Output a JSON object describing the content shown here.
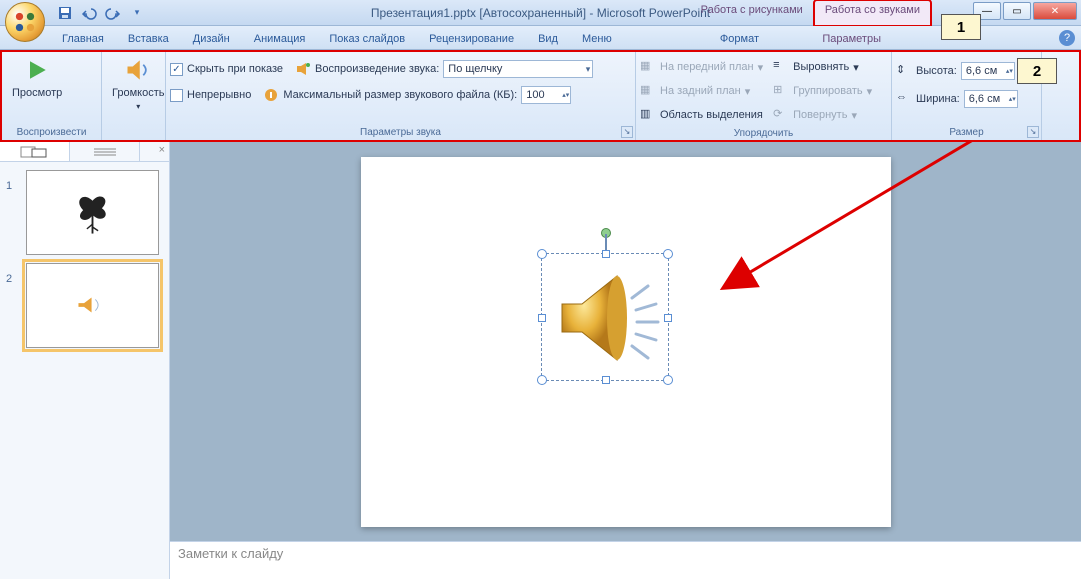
{
  "title": "Презентация1.pptx [Автосохраненный] - Microsoft PowerPoint",
  "context_tabs": {
    "pictures": "Работа с рисунками",
    "sounds": "Работа со звуками"
  },
  "callouts": {
    "c1": "1",
    "c2": "2"
  },
  "tabs": {
    "home": "Главная",
    "insert": "Вставка",
    "design": "Дизайн",
    "animation": "Анимация",
    "slideshow": "Показ слайдов",
    "review": "Рецензирование",
    "view": "Вид",
    "menu": "Меню",
    "format": "Формат",
    "params": "Параметры"
  },
  "ribbon": {
    "play_group": "Воспроизвести",
    "preview": "Просмотр",
    "volume": "Громкость",
    "sound_opts_group": "Параметры звука",
    "hide_on_show": "Скрыть при показе",
    "loop": "Непрерывно",
    "play_sound": "Воспроизведение звука:",
    "play_sound_val": "По щелчку",
    "max_size": "Максимальный размер звукового файла (КБ):",
    "max_size_val": "100",
    "arrange_group": "Упорядочить",
    "bring_front": "На передний план",
    "send_back": "На задний план",
    "selection_pane": "Область выделения",
    "align": "Выровнять",
    "group": "Группировать",
    "rotate": "Повернуть",
    "size_group": "Размер",
    "height": "Высота:",
    "height_val": "6,6 см",
    "width": "Ширина:",
    "width_val": "6,6 см"
  },
  "thumbs": {
    "n1": "1",
    "n2": "2"
  },
  "notes_placeholder": "Заметки к слайду"
}
